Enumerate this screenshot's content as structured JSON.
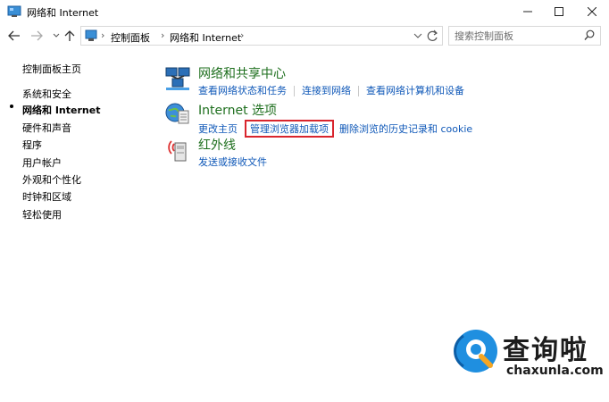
{
  "window": {
    "title": "网络和 Internet"
  },
  "nav": {
    "breadcrumbs": [
      "控制面板",
      "网络和 Internet"
    ],
    "search_placeholder": "搜索控制面板"
  },
  "sidebar": {
    "home": "控制面板主页",
    "items": [
      {
        "label": "系统和安全",
        "current": false
      },
      {
        "label": "网络和 Internet",
        "current": true
      },
      {
        "label": "硬件和声音",
        "current": false
      },
      {
        "label": "程序",
        "current": false
      },
      {
        "label": "用户帐户",
        "current": false
      },
      {
        "label": "外观和个性化",
        "current": false
      },
      {
        "label": "时钟和区域",
        "current": false
      },
      {
        "label": "轻松使用",
        "current": false
      }
    ]
  },
  "categories": [
    {
      "title": "网络和共享中心",
      "icon": "network-sharing-icon",
      "links": [
        "查看网络状态和任务",
        "连接到网络",
        "查看网络计算机和设备"
      ]
    },
    {
      "title": "Internet 选项",
      "icon": "internet-options-icon",
      "links": [
        "更改主页",
        "管理浏览器加载项",
        "删除浏览的历史记录和 cookie"
      ],
      "highlighted_link_index": 1
    },
    {
      "title": "红外线",
      "icon": "infrared-icon",
      "links": [
        "发送或接收文件"
      ]
    }
  ],
  "watermark": {
    "text": "查询啦",
    "url": "chaxunla.com"
  },
  "colors": {
    "link": "#0f58b8",
    "category_title": "#1e6f1e",
    "highlight_border": "#d9252d",
    "watermark_accent": "#1f8fe0",
    "watermark_accent2": "#f5a623"
  }
}
